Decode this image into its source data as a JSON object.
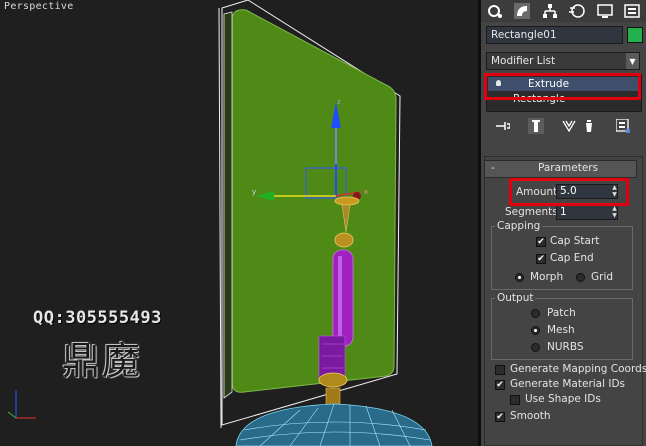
{
  "viewport": {
    "label": "Perspective",
    "watermark_qq": "QQ:305555493",
    "watermark_chars": "鼎魔",
    "axis_labels": {
      "x": "x",
      "y": "y",
      "z": "z"
    }
  },
  "panel": {
    "tabs": [
      {
        "name": "create-icon"
      },
      {
        "name": "modify-icon"
      },
      {
        "name": "hierarchy-icon"
      },
      {
        "name": "motion-icon"
      },
      {
        "name": "display-icon"
      },
      {
        "name": "utilities-icon"
      }
    ],
    "object_name": "Rectangle01",
    "object_color": "#22b14c",
    "modifier_list": "Modifier List",
    "stack": {
      "extrude": "Extrude",
      "rectangle": "Rectangle"
    },
    "parameters": {
      "title": "Parameters",
      "collapse": "-",
      "amount_label": "Amount:",
      "amount_value": "5.0",
      "segments_label": "Segments:",
      "segments_value": "1",
      "capping": {
        "title": "Capping",
        "cap_start": "Cap Start",
        "cap_end": "Cap End",
        "morph": "Morph",
        "grid": "Grid"
      },
      "output": {
        "title": "Output",
        "patch": "Patch",
        "mesh": "Mesh",
        "nurbs": "NURBS"
      },
      "gen_mapping": "Generate Mapping Coords.",
      "gen_material": "Generate Material IDs",
      "use_shape_ids": "Use Shape IDs",
      "smooth": "Smooth"
    },
    "highlight_color": "#e2000f"
  }
}
